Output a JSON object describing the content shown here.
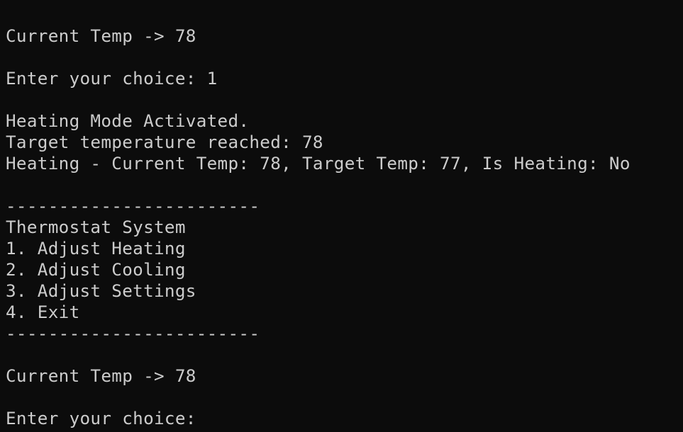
{
  "terminal": {
    "lines": [
      "Current Temp -> 78",
      "",
      "Enter your choice: 1",
      "",
      "Heating Mode Activated.",
      "Target temperature reached: 78",
      "Heating - Current Temp: 78, Target Temp: 77, Is Heating: No",
      "",
      "------------------------",
      "Thermostat System",
      "1. Adjust Heating",
      "2. Adjust Cooling",
      "3. Adjust Settings",
      "4. Exit",
      "------------------------",
      "",
      "Current Temp -> 78",
      ""
    ],
    "prompt": "Enter your choice: "
  },
  "colors": {
    "background": "#0c0c0c",
    "foreground": "#cccccc"
  }
}
